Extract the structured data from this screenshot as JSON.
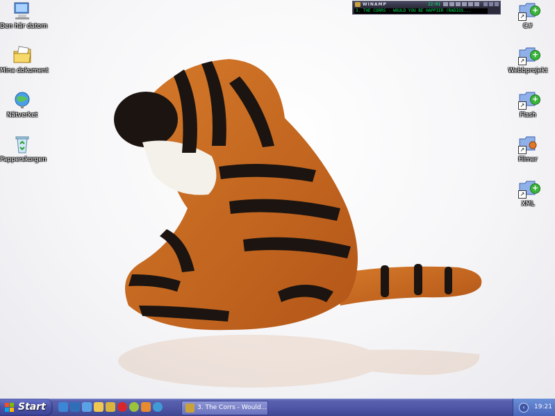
{
  "desktop": {
    "left_icons": [
      {
        "label": "Den här datorn",
        "icon": "my-computer-icon"
      },
      {
        "label": "Mina dokument",
        "icon": "my-documents-icon"
      },
      {
        "label": "Nätverket",
        "icon": "network-icon"
      },
      {
        "label": "Papperskorgen",
        "icon": "recycle-bin-icon"
      }
    ],
    "right_icons": [
      {
        "label": "C#",
        "icon": "folder-shortcut-icon"
      },
      {
        "label": "Webbprojekt",
        "icon": "folder-shortcut-icon"
      },
      {
        "label": "Flash",
        "icon": "folder-shortcut-icon"
      },
      {
        "label": "Filmer",
        "icon": "folder-shortcut-icon"
      },
      {
        "label": "XML",
        "icon": "folder-shortcut-icon"
      }
    ],
    "wallpaper": "tiger-plush-icon"
  },
  "winamp": {
    "title": "WINAMP",
    "time": "22:01",
    "track": "3. THE CORRS - WOULD YOU BE HAPPIER (RADIOS..."
  },
  "taskbar": {
    "start_label": "Start",
    "task_label": "3. The Corrs - Would...",
    "clock": "19:21"
  },
  "colors": {
    "taskbar": "#4c54a3",
    "tiger_orange": "#c5661f",
    "tiger_stripe": "#1b1410"
  }
}
